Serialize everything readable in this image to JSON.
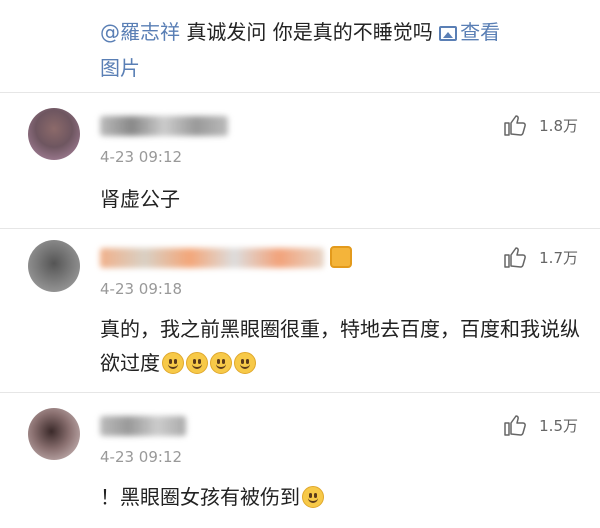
{
  "post": {
    "mention": "@羅志祥",
    "text": " 真诚发问 你是真的不睡觉吗 ",
    "link_label_1": "查看",
    "link_label_2": "图片"
  },
  "comments": [
    {
      "time": "4-23 09:12",
      "likes": "1.8万",
      "content": "肾虚公子"
    },
    {
      "time": "4-23 09:18",
      "likes": "1.7万",
      "content": "真的，我之前黑眼圈很重，特地去百度，百度和我说纵欲过度"
    },
    {
      "time": "4-23 09:12",
      "likes": "1.5万",
      "content": "！黑眼圈女孩有被伤到"
    }
  ],
  "colors": {
    "link": "#5a7fb5",
    "time": "#999999",
    "text": "#222222"
  }
}
